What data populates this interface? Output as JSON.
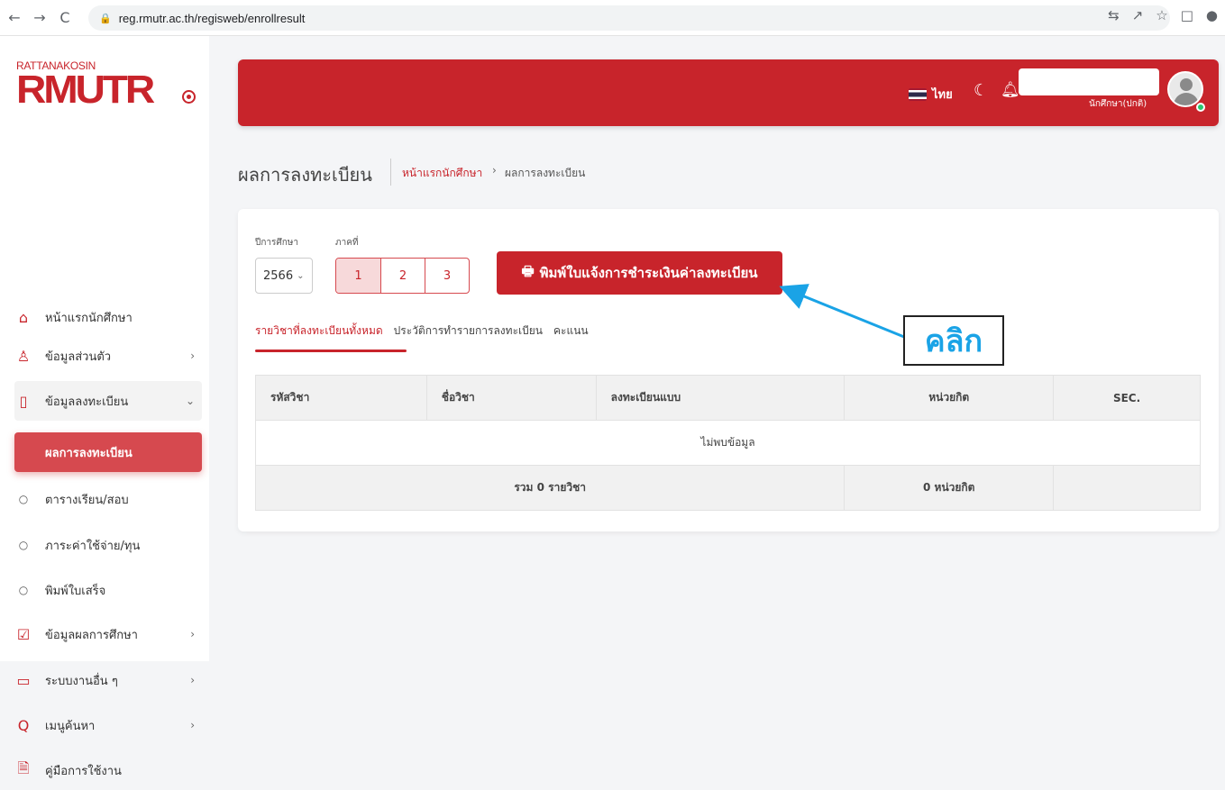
{
  "browser": {
    "url": "reg.rmutr.ac.th/regisweb/enrollresult"
  },
  "logo": {
    "small_text": "RATTANAKOSIN",
    "big_text": "RMUTR"
  },
  "sidebar": {
    "items": [
      {
        "label": "หน้าแรกนักศึกษา",
        "icon": "home-icon"
      },
      {
        "label": "ข้อมูลส่วนตัว",
        "icon": "user-icon"
      },
      {
        "label": "ข้อมูลลงทะเบียน",
        "icon": "tablet-icon"
      },
      {
        "label": "ผลการลงทะเบียน",
        "icon": "circle-icon"
      },
      {
        "label": "ตารางเรียน/สอบ",
        "icon": "circle-icon"
      },
      {
        "label": "ภาระค่าใช้จ่าย/ทุน",
        "icon": "circle-icon"
      },
      {
        "label": "พิมพ์ใบเสร็จ",
        "icon": "circle-icon"
      },
      {
        "label": "ข้อมูลผลการศึกษา",
        "icon": "checkbox-icon"
      },
      {
        "label": "ระบบงานอื่น ๆ",
        "icon": "clipboard-icon"
      },
      {
        "label": "เมนูค้นหา",
        "icon": "search-icon"
      },
      {
        "label": "คู่มือการใช้งาน",
        "icon": "document-icon"
      }
    ]
  },
  "header": {
    "language": "ไทย",
    "role": "นักศึกษา(ปกติ)",
    "accent_color": "#c8242b"
  },
  "page": {
    "title": "ผลการลงทะเบียน",
    "breadcrumb_link": "หน้าแรกนักศึกษา",
    "breadcrumb_sep": "›",
    "breadcrumb_current": "ผลการลงทะเบียน"
  },
  "filters": {
    "year_label": "ปีการศึกษา",
    "year_value": "2566",
    "term_label": "ภาคที่",
    "terms": [
      "1",
      "2",
      "3"
    ],
    "print_label": "พิมพ์ใบแจ้งการชำระเงินค่าลงทะเบียน"
  },
  "tabs": [
    "รายวิชาที่ลงทะเบียนทั้งหมด",
    "ประวัติการทำรายการลงทะเบียน",
    "คะแนน"
  ],
  "table": {
    "headers": [
      "รหัสวิชา",
      "ชื่อวิชา",
      "ลงทะเบียนแบบ",
      "หน่วยกิต",
      "SEC."
    ],
    "empty_text": "ไม่พบข้อมูล",
    "summary_courses": "รวม 0 รายวิชา",
    "summary_credits": "0 หน่วยกิต"
  },
  "annotation": {
    "text": "คลิก",
    "color": "#1aa3e6"
  }
}
